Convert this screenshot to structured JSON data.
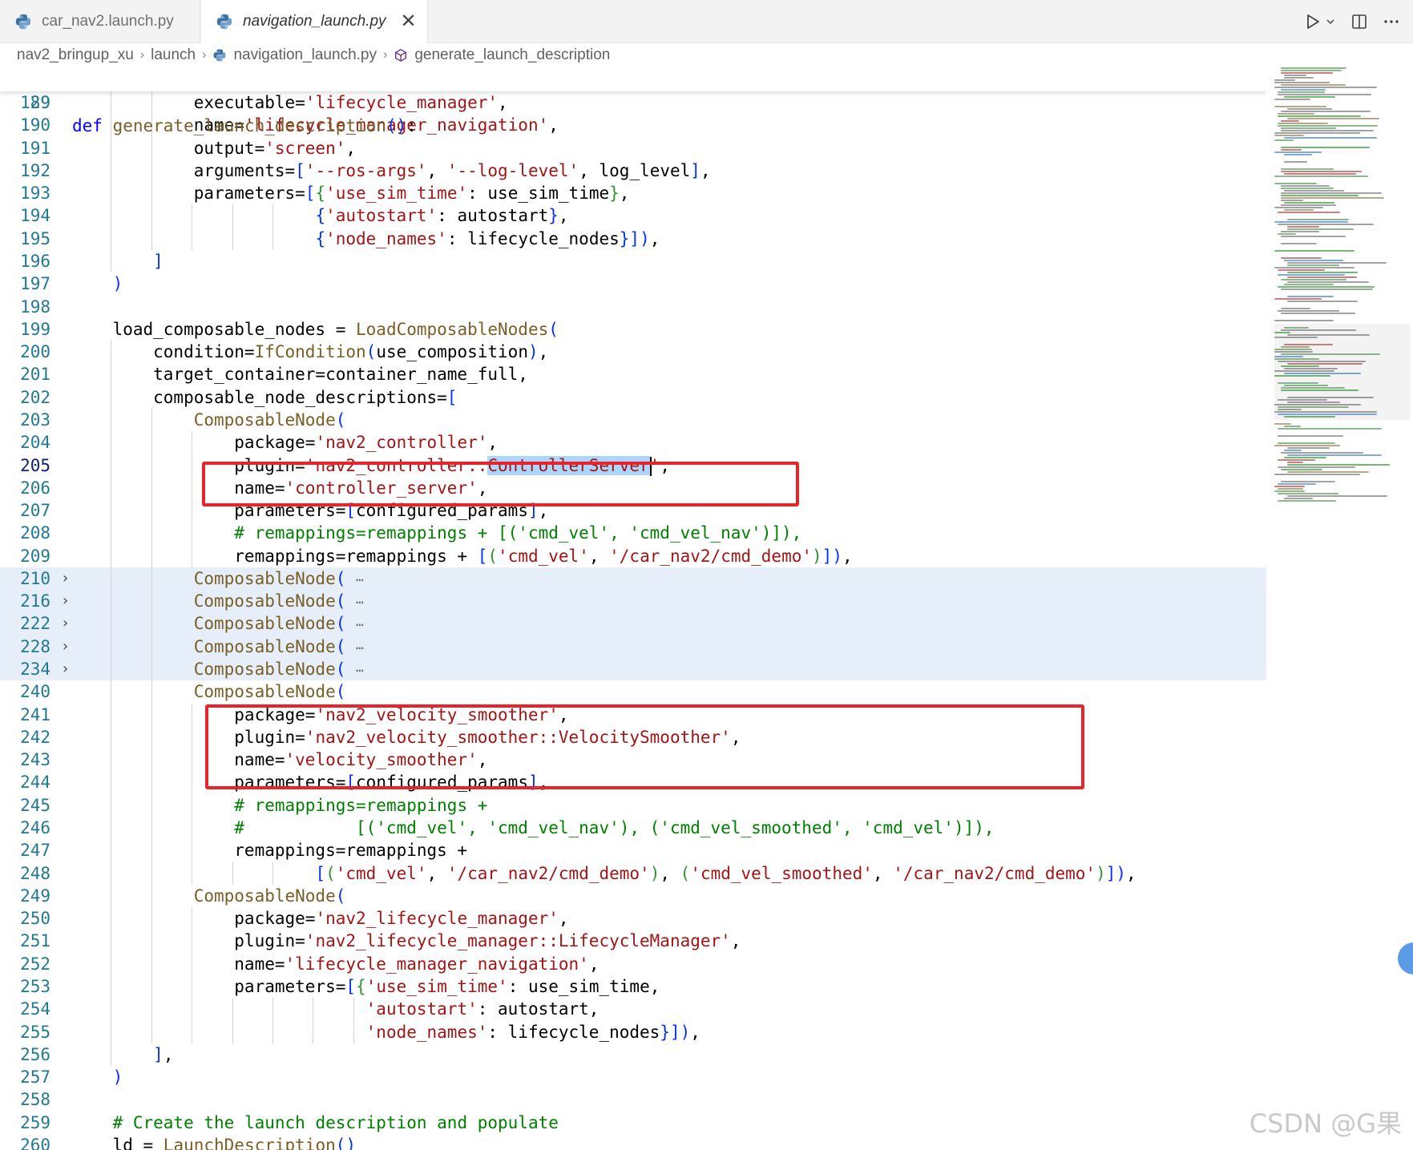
{
  "tabs": [
    {
      "label": "car_nav2.launch.py",
      "active": false
    },
    {
      "label": "navigation_launch.py",
      "active": true
    }
  ],
  "breadcrumb": [
    "nav2_bringup_xu",
    "launch",
    "navigation_launch.py",
    "generate_launch_description"
  ],
  "sticky": {
    "number": "29",
    "text": "def generate_launch_description():"
  },
  "current_line": "205",
  "lines": [
    {
      "n": "189",
      "text": "            executable='lifecycle_manager',"
    },
    {
      "n": "190",
      "text": "            name='lifecycle_manager_navigation',"
    },
    {
      "n": "191",
      "text": "            output='screen',"
    },
    {
      "n": "192",
      "text": "            arguments=['--ros-args', '--log-level', log_level],"
    },
    {
      "n": "193",
      "text": "            parameters=[{'use_sim_time': use_sim_time},"
    },
    {
      "n": "194",
      "text": "                        {'autostart': autostart},"
    },
    {
      "n": "195",
      "text": "                        {'node_names': lifecycle_nodes}]),"
    },
    {
      "n": "196",
      "text": "        ]"
    },
    {
      "n": "197",
      "text": "    )"
    },
    {
      "n": "198",
      "text": ""
    },
    {
      "n": "199",
      "text": "    load_composable_nodes = LoadComposableNodes("
    },
    {
      "n": "200",
      "text": "        condition=IfCondition(use_composition),"
    },
    {
      "n": "201",
      "text": "        target_container=container_name_full,"
    },
    {
      "n": "202",
      "text": "        composable_node_descriptions=["
    },
    {
      "n": "203",
      "text": "            ComposableNode("
    },
    {
      "n": "204",
      "text": "                package='nav2_controller',"
    },
    {
      "n": "205",
      "text": "                plugin='nav2_controller::ControllerServer',"
    },
    {
      "n": "206",
      "text": "                name='controller_server',"
    },
    {
      "n": "207",
      "text": "                parameters=[configured_params],"
    },
    {
      "n": "208",
      "text": "                # remappings=remappings + [('cmd_vel', 'cmd_vel_nav')]),"
    },
    {
      "n": "209",
      "text": "                remappings=remappings + [('cmd_vel', '/car_nav2/cmd_demo')]),"
    },
    {
      "n": "210",
      "text": "            ComposableNode(",
      "folded": true
    },
    {
      "n": "216",
      "text": "            ComposableNode(",
      "folded": true
    },
    {
      "n": "222",
      "text": "            ComposableNode(",
      "folded": true
    },
    {
      "n": "228",
      "text": "            ComposableNode(",
      "folded": true
    },
    {
      "n": "234",
      "text": "            ComposableNode(",
      "folded": true
    },
    {
      "n": "240",
      "text": "            ComposableNode("
    },
    {
      "n": "241",
      "text": "                package='nav2_velocity_smoother',"
    },
    {
      "n": "242",
      "text": "                plugin='nav2_velocity_smoother::VelocitySmoother',"
    },
    {
      "n": "243",
      "text": "                name='velocity_smoother',"
    },
    {
      "n": "244",
      "text": "                parameters=[configured_params],"
    },
    {
      "n": "245",
      "text": "                # remappings=remappings +"
    },
    {
      "n": "246",
      "text": "                #           [('cmd_vel', 'cmd_vel_nav'), ('cmd_vel_smoothed', 'cmd_vel')]),"
    },
    {
      "n": "247",
      "text": "                remappings=remappings +"
    },
    {
      "n": "248",
      "text": "                        [('cmd_vel', '/car_nav2/cmd_demo'), ('cmd_vel_smoothed', '/car_nav2/cmd_demo')]),"
    },
    {
      "n": "249",
      "text": "            ComposableNode("
    },
    {
      "n": "250",
      "text": "                package='nav2_lifecycle_manager',"
    },
    {
      "n": "251",
      "text": "                plugin='nav2_lifecycle_manager::LifecycleManager',"
    },
    {
      "n": "252",
      "text": "                name='lifecycle_manager_navigation',"
    },
    {
      "n": "253",
      "text": "                parameters=[{'use_sim_time': use_sim_time,"
    },
    {
      "n": "254",
      "text": "                             'autostart': autostart,"
    },
    {
      "n": "255",
      "text": "                             'node_names': lifecycle_nodes}]),"
    },
    {
      "n": "256",
      "text": "        ],"
    },
    {
      "n": "257",
      "text": "    )"
    },
    {
      "n": "258",
      "text": ""
    },
    {
      "n": "259",
      "text": "    # Create the launch description and populate"
    },
    {
      "n": "260",
      "text": "    ld = LaunchDescription()"
    }
  ],
  "selection": "ControllerServer",
  "highlight_boxes": [
    {
      "from": "208",
      "to": "209"
    },
    {
      "from": "245",
      "to": "248"
    }
  ],
  "watermark": "CSDN @G果",
  "colors": {
    "keyword": "#0000ff",
    "function": "#795e26",
    "string": "#a31515",
    "comment": "#008000",
    "line_number": "#237893",
    "folded_bg": "#e5eef9",
    "selection": "#add6ff",
    "highlight_box": "#e8232a"
  },
  "icons": {
    "tab_file": "python-file-icon",
    "tab_close": "close-icon",
    "run": "run-icon",
    "run_menu": "chevron-down-icon",
    "split": "split-editor-icon",
    "more": "more-icon",
    "crumb_file": "python-file-icon",
    "crumb_symbol": "cube-symbol-icon",
    "fold": "chevron-right-icon"
  }
}
